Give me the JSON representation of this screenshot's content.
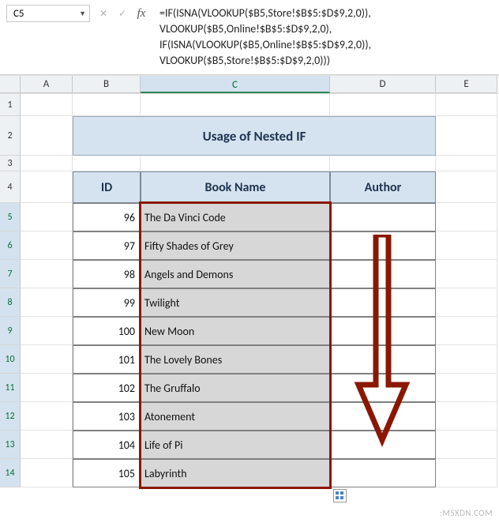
{
  "name_box": "C5",
  "formula_lines": [
    "=IF(ISNA(VLOOKUP($B5,Store!$B$5:$D$9,2,0)),",
    "VLOOKUP($B5,Online!$B$5:$D$9,2,0),",
    "IF(ISNA(VLOOKUP($B5,Online!$B$5:$D$9,2,0)),",
    "VLOOKUP($B5,Store!$B$5:$D$9,2,0)))"
  ],
  "columns": [
    "A",
    "B",
    "C",
    "D",
    "E"
  ],
  "row_nums": [
    "1",
    "2",
    "3",
    "4",
    "5",
    "6",
    "7",
    "8",
    "9",
    "10",
    "11",
    "12",
    "13",
    "14"
  ],
  "title": "Usage of Nested IF",
  "headers": {
    "id": "ID",
    "name": "Book Name",
    "author": "Author"
  },
  "rows": [
    {
      "id": "96",
      "name": "The Da Vinci Code",
      "author": ""
    },
    {
      "id": "97",
      "name": "Fifty Shades of Grey",
      "author": ""
    },
    {
      "id": "98",
      "name": "Angels and Demons",
      "author": ""
    },
    {
      "id": "99",
      "name": "Twilight",
      "author": ""
    },
    {
      "id": "100",
      "name": "New Moon",
      "author": ""
    },
    {
      "id": "101",
      "name": "The Lovely Bones",
      "author": ""
    },
    {
      "id": "102",
      "name": "The Gruffalo",
      "author": ""
    },
    {
      "id": "103",
      "name": "Atonement",
      "author": ""
    },
    {
      "id": "104",
      "name": "Life of Pi",
      "author": ""
    },
    {
      "id": "105",
      "name": "Labyrinth",
      "author": ""
    }
  ],
  "watermark": ":MSXDN.COM",
  "colors": {
    "header_fill": "#d5e3f0",
    "selection_fill": "#d7d7d7",
    "highlight_border": "#8a1800"
  }
}
